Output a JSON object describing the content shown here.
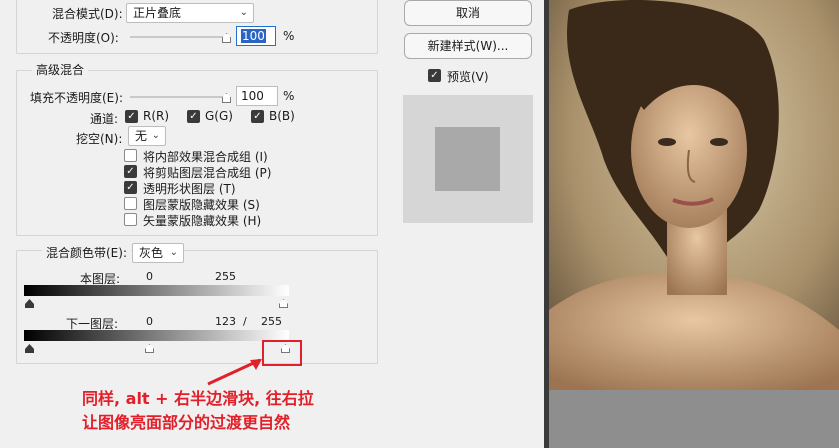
{
  "blend": {
    "mode_label": "混合模式(D):",
    "mode_value": "正片叠底",
    "opacity_label": "不透明度(O):",
    "opacity_value": "100",
    "opacity_unit": "%"
  },
  "advanced": {
    "title": "高级混合",
    "fill_label": "填充不透明度(E):",
    "fill_value": "100",
    "fill_unit": "%",
    "channels_label": "通道:",
    "channels": [
      {
        "label": "R(R)",
        "checked": true
      },
      {
        "label": "G(G)",
        "checked": true
      },
      {
        "label": "B(B)",
        "checked": true
      }
    ],
    "knockout_label": "挖空(N):",
    "knockout_value": "无",
    "options": [
      {
        "label": "将内部效果混合成组 (I)",
        "checked": false
      },
      {
        "label": "将剪贴图层混合成组 (P)",
        "checked": true
      },
      {
        "label": "透明形状图层 (T)",
        "checked": true
      },
      {
        "label": "图层蒙版隐藏效果 (S)",
        "checked": false
      },
      {
        "label": "矢量蒙版隐藏效果 (H)",
        "checked": false
      }
    ]
  },
  "blend_if": {
    "label": "混合颜色带(E):",
    "value": "灰色",
    "this_layer_label": "本图层:",
    "this_low": "0",
    "this_high": "255",
    "under_layer_label": "下一图层:",
    "under_low": "0",
    "under_split_a": "123",
    "under_slash": "/",
    "under_split_b": "255"
  },
  "buttons": {
    "cancel": "取消",
    "new_style": "新建样式(W)...",
    "preview_label": "预览(V)",
    "preview_checked": true
  },
  "annotation": {
    "line1": "同样, alt + 右半边滑块, 往右拉",
    "line2": "让图像亮面部分的过渡更自然",
    "color": "#e0202a"
  },
  "colors": {
    "dialog_bg": "#f0f0f0",
    "preview_square_outer": "#d6d6d6",
    "preview_square_inner": "#a9a9a9"
  }
}
